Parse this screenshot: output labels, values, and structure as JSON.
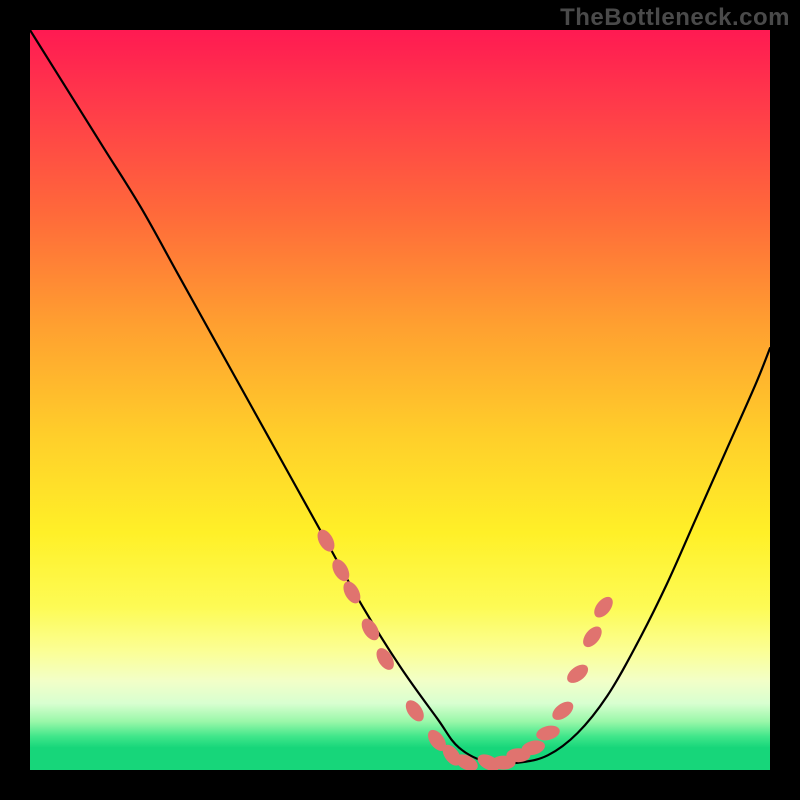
{
  "watermark": "TheBottleneck.com",
  "chart_data": {
    "type": "line",
    "title": "",
    "xlabel": "",
    "ylabel": "",
    "xlim": [
      0,
      100
    ],
    "ylim": [
      0,
      100
    ],
    "series": [
      {
        "name": "curve",
        "x": [
          0,
          5,
          10,
          15,
          20,
          25,
          30,
          35,
          40,
          45,
          50,
          55,
          58,
          62,
          66,
          70,
          74,
          78,
          82,
          86,
          90,
          94,
          98,
          100
        ],
        "y": [
          100,
          92,
          84,
          76,
          67,
          58,
          49,
          40,
          31,
          22,
          14,
          7,
          3,
          1,
          1,
          2,
          5,
          10,
          17,
          25,
          34,
          43,
          52,
          57
        ]
      }
    ],
    "markers": {
      "name": "highlight-dots",
      "color": "#e0736f",
      "points": [
        {
          "x": 40,
          "y": 31
        },
        {
          "x": 42,
          "y": 27
        },
        {
          "x": 43.5,
          "y": 24
        },
        {
          "x": 46,
          "y": 19
        },
        {
          "x": 48,
          "y": 15
        },
        {
          "x": 52,
          "y": 8
        },
        {
          "x": 55,
          "y": 4
        },
        {
          "x": 57,
          "y": 2
        },
        {
          "x": 59,
          "y": 1
        },
        {
          "x": 62,
          "y": 1
        },
        {
          "x": 64,
          "y": 1
        },
        {
          "x": 66,
          "y": 2
        },
        {
          "x": 68,
          "y": 3
        },
        {
          "x": 70,
          "y": 5
        },
        {
          "x": 72,
          "y": 8
        },
        {
          "x": 74,
          "y": 13
        },
        {
          "x": 76,
          "y": 18
        },
        {
          "x": 77.5,
          "y": 22
        }
      ]
    },
    "gradient_stops": [
      {
        "pos": 0.0,
        "color": "#ff1a52"
      },
      {
        "pos": 0.1,
        "color": "#ff3a4a"
      },
      {
        "pos": 0.25,
        "color": "#ff6a3a"
      },
      {
        "pos": 0.4,
        "color": "#ffa030"
      },
      {
        "pos": 0.55,
        "color": "#ffcf2a"
      },
      {
        "pos": 0.68,
        "color": "#fff028"
      },
      {
        "pos": 0.78,
        "color": "#fdfb55"
      },
      {
        "pos": 0.84,
        "color": "#fbff96"
      },
      {
        "pos": 0.88,
        "color": "#f2ffc8"
      },
      {
        "pos": 0.91,
        "color": "#d8ffd0"
      },
      {
        "pos": 0.935,
        "color": "#98f7a8"
      },
      {
        "pos": 0.955,
        "color": "#3fe68a"
      },
      {
        "pos": 0.97,
        "color": "#17d67a"
      },
      {
        "pos": 1.0,
        "color": "#17d67a"
      }
    ]
  }
}
